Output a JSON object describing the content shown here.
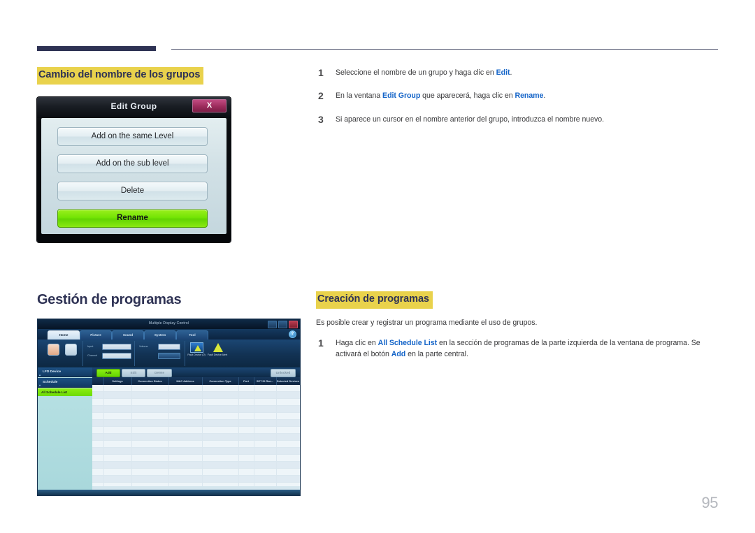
{
  "page": {
    "number": "95"
  },
  "section1": {
    "heading": "Cambio del nombre de los grupos",
    "steps": [
      {
        "num": "1",
        "html": "Seleccione el nombre de un grupo y haga clic en <b>Edit</b>."
      },
      {
        "num": "2",
        "html": "En la ventana <b>Edit Group</b> que aparecerá, haga clic en <b>Rename</b>."
      },
      {
        "num": "3",
        "html": "Si aparece un cursor en el nombre anterior del grupo, introduzca el nombre nuevo."
      }
    ]
  },
  "dialog": {
    "title": "Edit Group",
    "close_label": "X",
    "buttons": [
      {
        "label": "Add on the same Level",
        "primary": false
      },
      {
        "label": "Add on the sub level",
        "primary": false
      },
      {
        "label": "Delete",
        "primary": false
      },
      {
        "label": "Rename",
        "primary": true
      }
    ]
  },
  "section2": {
    "heading": "Gestión de programas",
    "sub_heading": "Creación de programas",
    "lead": "Es posible crear y registrar un programa mediante el uso de grupos.",
    "steps": [
      {
        "num": "1",
        "html": "Haga clic en <b>All Schedule List</b> en la sección de programas de la parte izquierda de la ventana de programa. Se activará el botón <b>Add</b> en la parte central."
      }
    ]
  },
  "appshot": {
    "title": "Multiple Display Control",
    "help_label": "?",
    "tabs": [
      {
        "label": "Home",
        "active": true
      },
      {
        "label": "Picture",
        "active": false
      },
      {
        "label": "Sound",
        "active": false
      },
      {
        "label": "System",
        "active": false
      },
      {
        "label": "Tool",
        "active": false
      }
    ],
    "ribbon": {
      "field_labels": [
        "Input",
        "Channel",
        "Volume"
      ],
      "apply_label": "Apply",
      "fault_device": "Fault Device (0)",
      "fault_device_alert": "Fault Device Alert"
    },
    "sidebar": {
      "items": [
        {
          "label": "LFD Device",
          "caret": "▴"
        },
        {
          "label": "Schedule",
          "caret": "▾"
        }
      ],
      "selected": "All Schedule List"
    },
    "toolbar": {
      "add_label": "Add",
      "edit_label": "Edit",
      "delete_label": "Delete",
      "right_label": "Unlocked"
    },
    "grid": {
      "columns": [
        "Settings",
        "Connection Status",
        "MAC Address",
        "Connection Type",
        "Port",
        "SET ID Ran...",
        "Detected Devices"
      ]
    }
  },
  "colors": {
    "accent_navy": "#2e3254",
    "highlight_yellow": "#e9d24c",
    "link_blue": "#1464c8",
    "primary_green": "#74e505"
  }
}
